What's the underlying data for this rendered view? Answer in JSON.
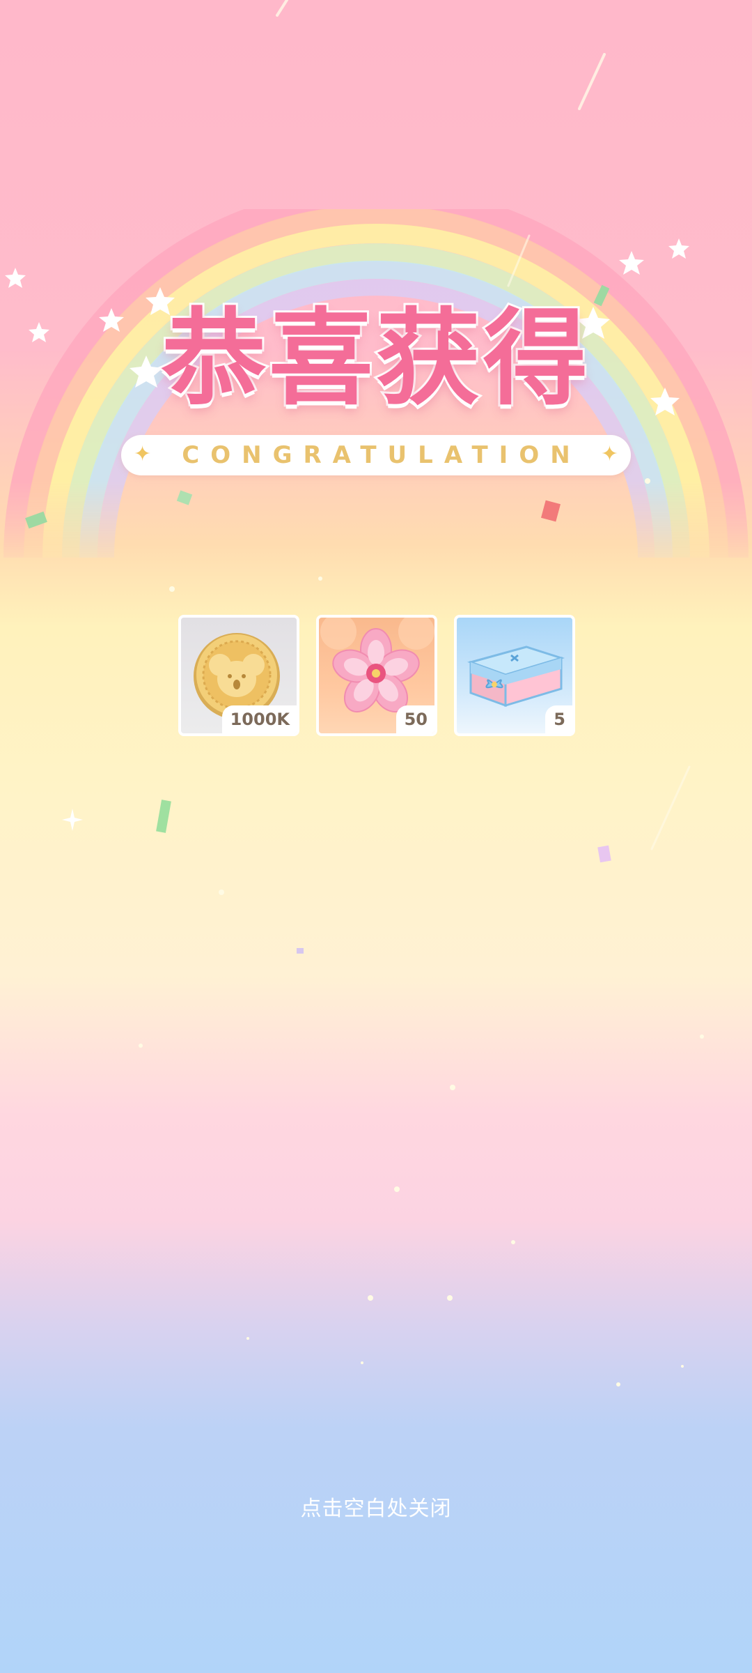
{
  "title": {
    "main": "恭喜获得",
    "subtitle": "CONGRATULATION"
  },
  "rewards": [
    {
      "name": "coin",
      "icon": "koala-coin-icon",
      "quantity": "1000K"
    },
    {
      "name": "sakura",
      "icon": "sakura-flower-icon",
      "quantity": "50"
    },
    {
      "name": "gift-box",
      "icon": "gift-box-icon",
      "quantity": "5"
    }
  ],
  "close_hint": "点击空白处关闭",
  "colors": {
    "title": "#f46d98",
    "subtitle": "#e9c26e",
    "background_top": "#ffb8ca",
    "background_bottom": "#b1d4f9"
  }
}
